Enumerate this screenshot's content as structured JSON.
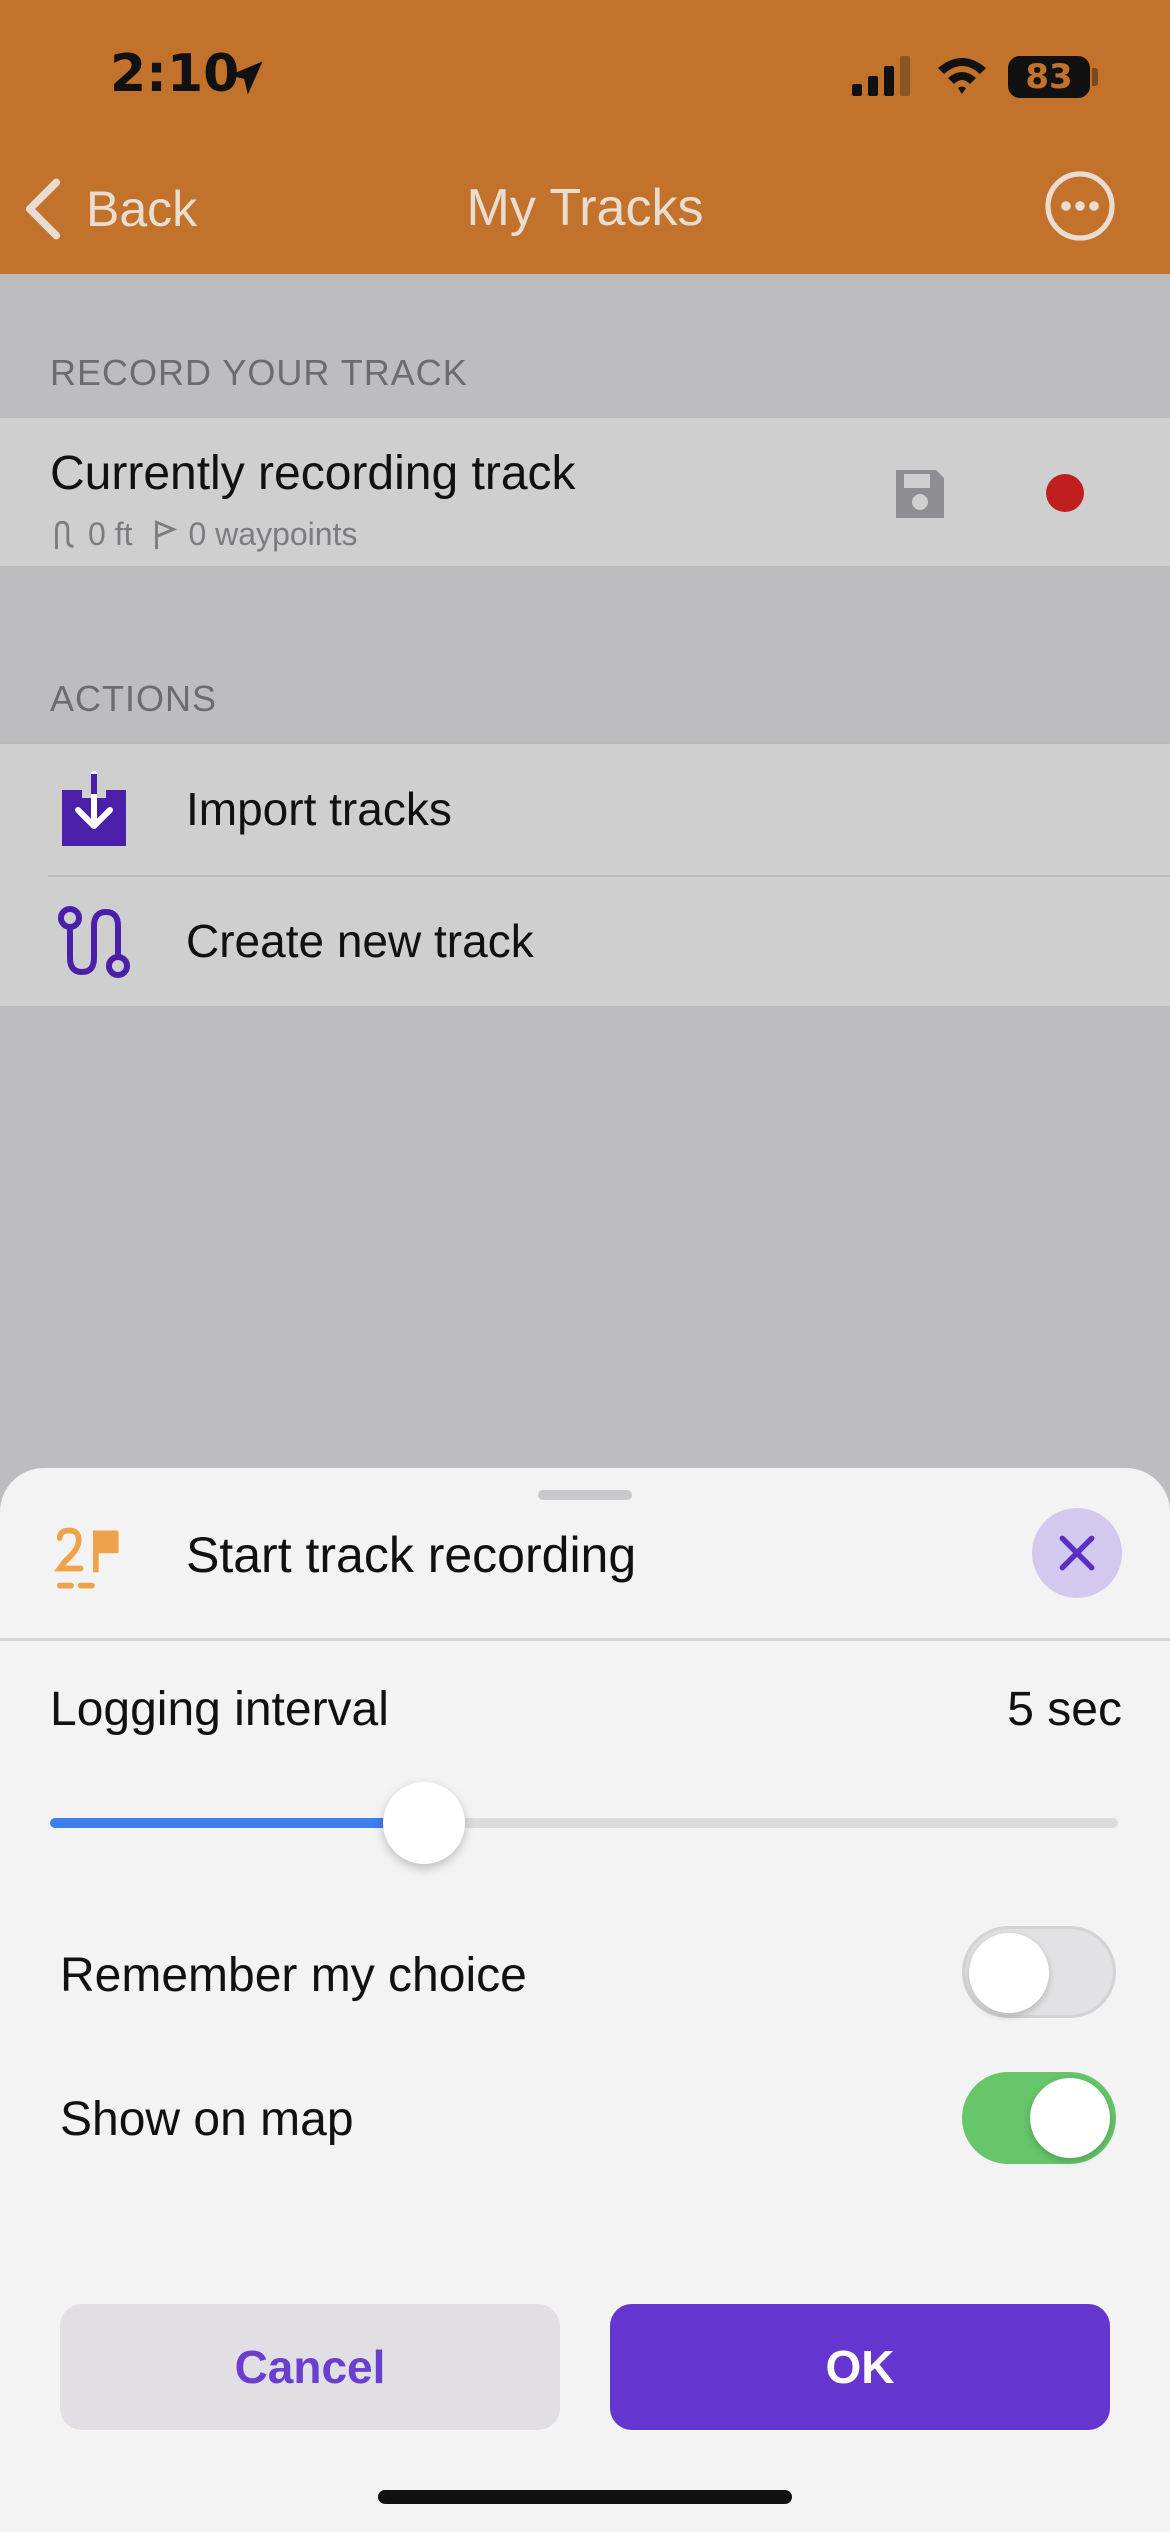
{
  "status_bar": {
    "time": "2:10",
    "battery": "83",
    "icons": [
      "location-arrow-icon",
      "signal-icon",
      "wifi-icon",
      "battery-icon"
    ]
  },
  "nav": {
    "back_label": "Back",
    "title": "My Tracks",
    "more_icon": "ellipsis-circle-icon"
  },
  "record_section": {
    "header": "RECORD YOUR TRACK",
    "track": {
      "title": "Currently recording track",
      "distance": "0 ft",
      "waypoints": "0 waypoints",
      "icons": [
        "route-icon",
        "flag-icon",
        "save-icon",
        "record-dot-icon"
      ]
    }
  },
  "actions_section": {
    "header": "ACTIONS",
    "items": [
      {
        "label": "Import tracks",
        "icon": "import-arrow-icon"
      },
      {
        "label": "Create new track",
        "icon": "track-path-icon"
      }
    ]
  },
  "sheet": {
    "title": "Start track recording",
    "icon": "track-flag-icon",
    "close_icon": "close-icon",
    "logging_interval_label": "Logging interval",
    "logging_interval_value": "5 sec",
    "slider_fraction": 0.35,
    "toggles": [
      {
        "label": "Remember my choice",
        "on": false
      },
      {
        "label": "Show on map",
        "on": true
      }
    ],
    "cancel_label": "Cancel",
    "ok_label": "OK"
  },
  "colors": {
    "header_orange": "#c2722a",
    "accent_purple": "#6536cf",
    "slider_blue": "#3c7ef0",
    "switch_green": "#67c56a",
    "record_red": "#c0201d"
  }
}
